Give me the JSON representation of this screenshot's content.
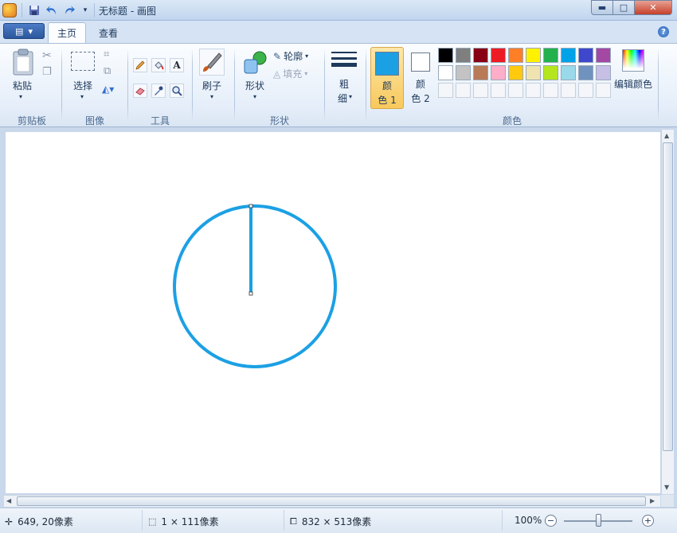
{
  "window": {
    "title": "无标题 - 画图"
  },
  "tabs": [
    {
      "label": "主页",
      "active": true
    },
    {
      "label": "查看",
      "active": false
    }
  ],
  "ribbon": {
    "clipboard": {
      "paste_label": "粘贴",
      "group_label": "剪贴板"
    },
    "image": {
      "select_label": "选择",
      "group_label": "图像"
    },
    "tools": {
      "group_label": "工具",
      "text_tool": "A"
    },
    "brushes": {
      "label": "刷子"
    },
    "shapes": {
      "label": "形状",
      "outline_label": "轮廓",
      "fill_label": "填充",
      "group_label": "形状"
    },
    "size": {
      "label_top": "粗",
      "label_bottom": "细"
    },
    "colors": {
      "color1_label_top": "颜",
      "color1_label_bottom": "色 1",
      "color2_label_top": "颜",
      "color2_label_bottom": "色 2",
      "edit_label": "编辑颜色",
      "group_label": "颜色",
      "color1": "#1ca0e4",
      "color2": "#ffffff",
      "palette_row1": [
        "#000000",
        "#7f7f7f",
        "#880015",
        "#ed1c24",
        "#ff7f27",
        "#fff200",
        "#22b14c",
        "#00a2e8",
        "#3f48cc",
        "#a349a4"
      ],
      "palette_row2": [
        "#ffffff",
        "#c3c3c3",
        "#b97a57",
        "#ffaec9",
        "#ffc90e",
        "#efe4b0",
        "#b5e61d",
        "#99d9ea",
        "#7092be",
        "#c8bfe7"
      ]
    }
  },
  "canvas_drawing": {
    "shape": "circle",
    "stroke_color": "#1ca0e4"
  },
  "status": {
    "cursor_pos": "649, 20像素",
    "selection_size": "1 × 111像素",
    "canvas_size": "832 × 513像素",
    "zoom": "100%"
  }
}
